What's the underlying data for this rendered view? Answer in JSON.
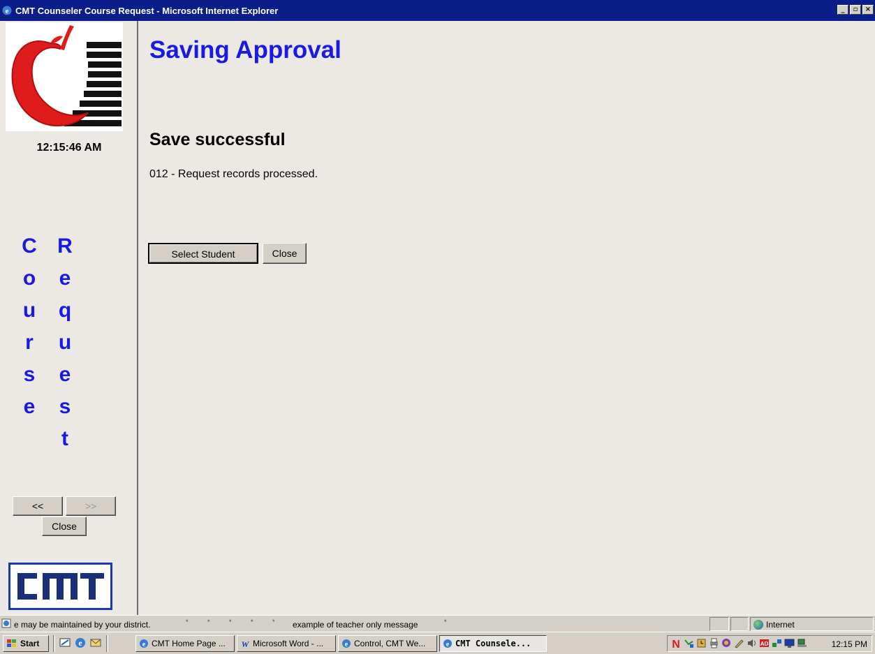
{
  "window": {
    "title": "CMT Counseler Course Request - Microsoft Internet Explorer",
    "minimize_icon": "minimize-icon",
    "restore_icon": "restore-icon",
    "close_icon": "close-icon"
  },
  "sidebar": {
    "clock": "12:15:46 AM",
    "vertical_word_1": [
      "C",
      "o",
      "u",
      "r",
      "s",
      "e"
    ],
    "vertical_word_2": [
      "R",
      "e",
      "q",
      "u",
      "e",
      "s",
      "t"
    ],
    "prev_label": "<<",
    "next_label": ">>",
    "close_label": "Close",
    "logo_icon": "apple-logo",
    "cmt_logo_text": "CMT"
  },
  "main": {
    "title": "Saving Approval",
    "subheading": "Save successful",
    "message": "012 - Request records processed.",
    "select_student_label": "Select Student",
    "close_label": "Close"
  },
  "statusbar": {
    "text": "e may be maintained by your district.",
    "text2": "example of teacher only message",
    "zone": "Internet"
  },
  "taskbar": {
    "start_label": "Start",
    "tasks": [
      {
        "label": "CMT Home Page ..."
      },
      {
        "label": "Microsoft Word - ..."
      },
      {
        "label": "Control, CMT We..."
      },
      {
        "label": "CMT Counsele..."
      }
    ],
    "clock": "12:15 PM"
  },
  "colors": {
    "title_bar": "#0a1e8a",
    "heading_blue": "#1a1ae6",
    "apple_red": "#e01b1b",
    "chrome": "#d4d0c8",
    "background": "#ece9e4"
  }
}
